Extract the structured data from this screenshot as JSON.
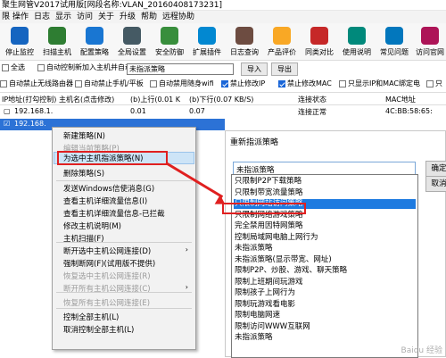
{
  "window": {
    "title": "聚生网管V2017试用版[网段名称:VLAN_20160408173231]"
  },
  "menu": [
    "限",
    "操作",
    "日志",
    "显示",
    "访问",
    "关于",
    "升级",
    "帮助",
    "远程协助"
  ],
  "toolbar": [
    {
      "label": "停止监控",
      "icon": "pause-icon",
      "color": "#1565c0"
    },
    {
      "label": "扫描主机",
      "icon": "scan-icon",
      "color": "#2e7d32"
    },
    {
      "label": "配置策略",
      "icon": "policy-icon",
      "color": "#1976d2"
    },
    {
      "label": "全局设置",
      "icon": "gear-icon",
      "color": "#455a64"
    },
    {
      "label": "安全防御",
      "icon": "shield-icon",
      "color": "#388e3c"
    },
    {
      "label": "扩展插件",
      "icon": "plugin-icon",
      "color": "#0288d1"
    },
    {
      "label": "日志查询",
      "icon": "log-icon",
      "color": "#6d4c41"
    },
    {
      "label": "产品评价",
      "icon": "rate-icon",
      "color": "#f9a825"
    },
    {
      "label": "同类对比",
      "icon": "compare-icon",
      "color": "#c62828"
    },
    {
      "label": "使用说明",
      "icon": "help-icon",
      "color": "#00897b"
    },
    {
      "label": "常见问题",
      "icon": "question-icon",
      "color": "#0277bd"
    },
    {
      "label": "访问官网",
      "icon": "home-icon",
      "color": "#ad1457"
    }
  ],
  "filters": {
    "select_all": "全选",
    "auto_control_new": "自动控制新加入主机并自动",
    "policy_select_value": "未指派策略",
    "import_label": "导入",
    "export_label": "导出",
    "auto_wireless_router": "自动禁止无线路由器",
    "auto_phone_pad": "自动禁止手机/平板",
    "auto_wifi": "自动禁用随身wifi",
    "forbid_ip": "禁止修改IP",
    "forbid_mac": "禁止修改MAC",
    "only_ip_mac": "只显示IP和MAC绑定电",
    "last": "只"
  },
  "table": {
    "headers": [
      "IP地址(打勾控制)",
      "主机名(点击修改)",
      "(b)上行(0.01 K",
      "(b)下行(0.07 KB/S)",
      "连接状态",
      "MAC地址"
    ],
    "rows": [
      {
        "ip": "192.168.1.",
        "host": "",
        "up": "0.01",
        "down": "0.07",
        "status": "连接正常",
        "mac": "4C:BB:58:65:"
      },
      {
        "ip": "192.168.",
        "host": "",
        "up": "",
        "down": "",
        "status": "",
        "mac": ""
      }
    ]
  },
  "context_menu": {
    "items": [
      {
        "label": "新建策略(N)",
        "disabled": false
      },
      {
        "label": "编辑当前策略(P)",
        "disabled": true
      },
      {
        "label": "为选中主机指派策略(N)",
        "disabled": false,
        "highlight": true
      },
      {
        "label": "删除策略(S)",
        "disabled": false
      },
      {
        "label": "发送Windows信使消息(G)",
        "disabled": false
      },
      {
        "label": "查看主机详细流量信息(I)",
        "disabled": false
      },
      {
        "label": "查看主机详细流量信息-已拦截",
        "disabled": false
      },
      {
        "label": "修改主机说明(M)",
        "disabled": false
      },
      {
        "label": "主机扫描(F)",
        "disabled": false
      },
      {
        "label": "断开选中主机公网连接(D)",
        "disabled": false,
        "submenu": true
      },
      {
        "label": "强制断网(F)(试用版不提供)",
        "disabled": false
      },
      {
        "label": "恢复选中主机公网连接(R)",
        "disabled": true
      },
      {
        "label": "断开所有主机公网连接(C)",
        "disabled": true,
        "submenu": true
      },
      {
        "label": "恢复所有主机公网连接(E)",
        "disabled": true
      },
      {
        "label": "控制全部主机(L)",
        "disabled": false
      },
      {
        "label": "取消控制全部主机(L)",
        "disabled": false
      }
    ]
  },
  "dialog": {
    "title": "重新指派策略",
    "dropdown_value": "未指派策略",
    "confirm_label": "确定",
    "cancel_label": "取消",
    "options": [
      "只限制P2P下载策略",
      "只限制带宽流量策略",
      "只限制网站访问策略",
      "只限制网络游戏策略",
      "完全禁用因特网策略",
      "控制局域网电脑上网行为",
      "未指派策略",
      "未指派策略(显示带宽、网址)",
      "限制P2P、炒股、游戏、聊天策略",
      "限制上班期间玩游戏",
      "限制孩子上网行为",
      "限制玩游戏看电影",
      "限制电脑网速",
      "限制访问WWW互联网",
      "未指派策略"
    ],
    "highlighted_index": 2
  },
  "watermark": "Baidu 经验",
  "colors": {
    "selection": "#2c72d6",
    "annotation": "#e02020",
    "highlight": "#1e7be0"
  }
}
